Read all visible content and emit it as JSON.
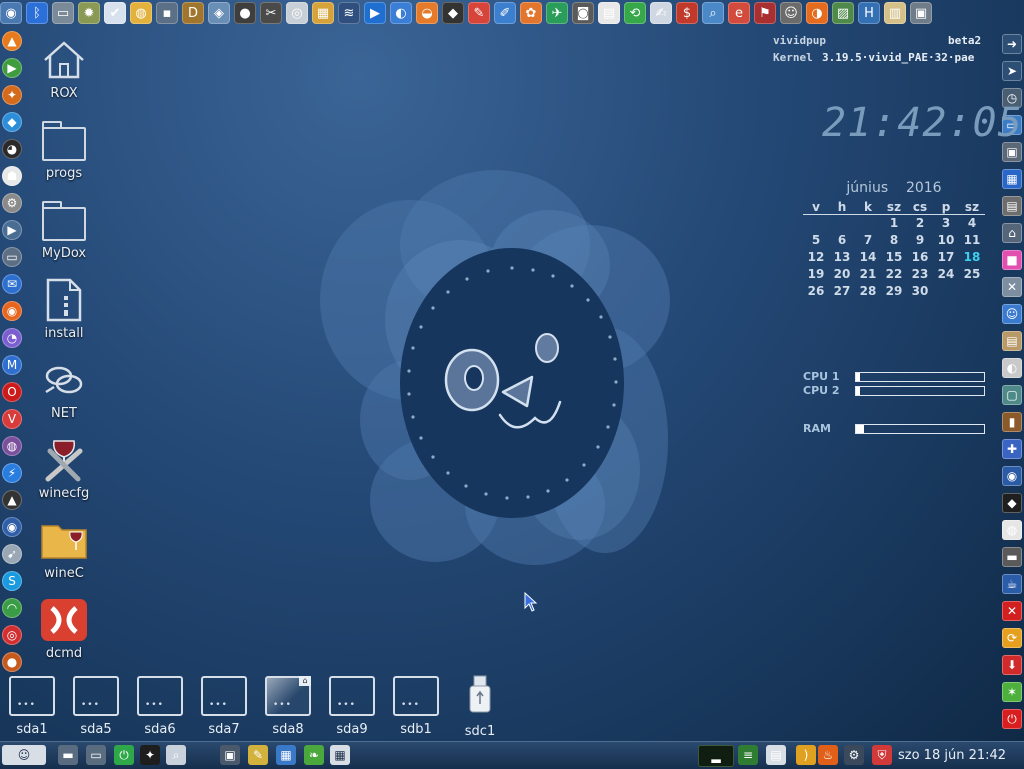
{
  "top_bar": {
    "icons": [
      {
        "name": "screenshot-icon",
        "glyph": "◉",
        "color": "#4a78b0"
      },
      {
        "name": "bluetooth-icon",
        "glyph": "ᛒ",
        "color": "#2b6fd8"
      },
      {
        "name": "drive-icon",
        "glyph": "▭",
        "color": "#7a8a99"
      },
      {
        "name": "sun-settings-icon",
        "glyph": "✹",
        "color": "#8a9a55"
      },
      {
        "name": "check-icon",
        "glyph": "✔",
        "color": "#d8e2ee"
      },
      {
        "name": "disc-icon",
        "glyph": "◍",
        "color": "#e3b23c"
      },
      {
        "name": "floppy-icon",
        "glyph": "▪",
        "color": "#5b6f86"
      },
      {
        "name": "dosbox-icon",
        "glyph": "D",
        "color": "#a0752d"
      },
      {
        "name": "cube-icon",
        "glyph": "◈",
        "color": "#6a8fb7"
      },
      {
        "name": "webcam-icon",
        "glyph": "●",
        "color": "#3e3e3e"
      },
      {
        "name": "tools-icon",
        "glyph": "✂",
        "color": "#4a4a4a"
      },
      {
        "name": "eye-icon",
        "glyph": "◎",
        "color": "#c8cfd6"
      },
      {
        "name": "film-icon",
        "glyph": "▦",
        "color": "#d6a33a"
      },
      {
        "name": "graph-icon",
        "glyph": "≋",
        "color": "#2f4f7f"
      },
      {
        "name": "media-player-icon",
        "glyph": "▶",
        "color": "#1f6fd0"
      },
      {
        "name": "network-icon",
        "glyph": "◐",
        "color": "#3a7ed6"
      },
      {
        "name": "blender-icon",
        "glyph": "◒",
        "color": "#e57b2a"
      },
      {
        "name": "inkscape-icon",
        "glyph": "◆",
        "color": "#333333"
      },
      {
        "name": "pencils-icon",
        "glyph": "✎",
        "color": "#d6443a"
      },
      {
        "name": "paint-icon",
        "glyph": "✐",
        "color": "#3c7fcf"
      },
      {
        "name": "xara-icon",
        "glyph": "✿",
        "color": "#e3762f"
      },
      {
        "name": "plane-icon",
        "glyph": "✈",
        "color": "#2a9d5a"
      },
      {
        "name": "camera-icon",
        "glyph": "◙",
        "color": "#5a5a5a"
      },
      {
        "name": "file-icon",
        "glyph": "▤",
        "color": "#e8e8e8"
      },
      {
        "name": "refresh-icon",
        "glyph": "⟲",
        "color": "#37a84a"
      },
      {
        "name": "notes-icon",
        "glyph": "✍",
        "color": "#cfd8e2"
      },
      {
        "name": "dollar-icon",
        "glyph": "$",
        "color": "#c0392b"
      },
      {
        "name": "magnifier-icon",
        "glyph": "⌕",
        "color": "#4b88c8"
      },
      {
        "name": "email-icon",
        "glyph": "e",
        "color": "#d24b3c"
      },
      {
        "name": "flag-icon",
        "glyph": "⚑",
        "color": "#a93030"
      },
      {
        "name": "pup-icon",
        "glyph": "☺",
        "color": "#6b6b6b"
      },
      {
        "name": "browser-icon",
        "glyph": "◑",
        "color": "#e56b1f"
      },
      {
        "name": "chart-icon",
        "glyph": "▨",
        "color": "#4f8a4a"
      },
      {
        "name": "h2-icon",
        "glyph": "H",
        "color": "#3470b4"
      },
      {
        "name": "book-icon",
        "glyph": "▥",
        "color": "#d4c088"
      },
      {
        "name": "chip-icon",
        "glyph": "▣",
        "color": "#6f7d8a"
      }
    ]
  },
  "left_dock": {
    "icons": [
      {
        "name": "vlc-icon",
        "glyph": "▲",
        "color": "#e67a1c"
      },
      {
        "name": "play-icon",
        "glyph": "▶",
        "color": "#3f9d3f"
      },
      {
        "name": "anchor-icon",
        "glyph": "✦",
        "color": "#d46a1c"
      },
      {
        "name": "kodi-icon",
        "glyph": "◆",
        "color": "#2c8dd8"
      },
      {
        "name": "penguin-icon",
        "glyph": "◕",
        "color": "#2a2a2a"
      },
      {
        "name": "ghost-icon",
        "glyph": "☗",
        "color": "#e8e8e8"
      },
      {
        "name": "tools-icon",
        "glyph": "⚙",
        "color": "#8a8a8a"
      },
      {
        "name": "media-icon",
        "glyph": "▶",
        "color": "#4a6d94"
      },
      {
        "name": "monitor-icon",
        "glyph": "▭",
        "color": "#5c6f84"
      },
      {
        "name": "thunderbird-icon",
        "glyph": "✉",
        "color": "#2c6fcf"
      },
      {
        "name": "firefox-icon",
        "glyph": "◉",
        "color": "#e8651e"
      },
      {
        "name": "pidgin-icon",
        "glyph": "◔",
        "color": "#7b5fd0"
      },
      {
        "name": "maxthon-icon",
        "glyph": "M",
        "color": "#2f6fd0"
      },
      {
        "name": "opera-icon",
        "glyph": "O",
        "color": "#cc1b1b"
      },
      {
        "name": "vivaldi-icon",
        "glyph": "V",
        "color": "#d93a3a"
      },
      {
        "name": "tor-icon",
        "glyph": "◍",
        "color": "#7a4f9c"
      },
      {
        "name": "messenger-icon",
        "glyph": "⚡",
        "color": "#2a7de0"
      },
      {
        "name": "triangle-icon",
        "glyph": "▲",
        "color": "#333333"
      },
      {
        "name": "earth-icon",
        "glyph": "◉",
        "color": "#2f5fa8"
      },
      {
        "name": "rocket-icon",
        "glyph": "➹",
        "color": "#9aa7b5"
      },
      {
        "name": "skype-icon",
        "glyph": "S",
        "color": "#1a9be0"
      },
      {
        "name": "rss-icon",
        "glyph": "◠",
        "color": "#3a9d45"
      },
      {
        "name": "lifebuoy-icon",
        "glyph": "◎",
        "color": "#d23030"
      },
      {
        "name": "orb-icon",
        "glyph": "●",
        "color": "#c65a1e"
      }
    ]
  },
  "right_dock": {
    "icons": [
      {
        "name": "logout-icon",
        "glyph": "➜",
        "color": "#2d4f75"
      },
      {
        "name": "cursor-icon",
        "glyph": "➤",
        "color": "#2d4f75"
      },
      {
        "name": "clock-icon",
        "glyph": "◷",
        "color": "#4a5e73"
      },
      {
        "name": "display-icon",
        "glyph": "▭",
        "color": "#3b7cc4"
      },
      {
        "name": "screen-icon",
        "glyph": "▣",
        "color": "#5a6878"
      },
      {
        "name": "driver-icon",
        "glyph": "▦",
        "color": "#2a66c8"
      },
      {
        "name": "printer-icon",
        "glyph": "▤",
        "color": "#6d6d6d"
      },
      {
        "name": "network-icon",
        "glyph": "⌂",
        "color": "#56667a"
      },
      {
        "name": "paint-icon",
        "glyph": "■",
        "color": "#e14fb0"
      },
      {
        "name": "wrench-icon",
        "glyph": "✕",
        "color": "#7d8ea0"
      },
      {
        "name": "face-icon",
        "glyph": "☺",
        "color": "#3a7bd0"
      },
      {
        "name": "doc-icon",
        "glyph": "▤",
        "color": "#b79a67"
      },
      {
        "name": "disc-icon",
        "glyph": "◐",
        "color": "#c9c9c9"
      },
      {
        "name": "monitor-icon",
        "glyph": "▢",
        "color": "#4f8a88"
      },
      {
        "name": "bottle-icon",
        "glyph": "▮",
        "color": "#8a5a2b"
      },
      {
        "name": "puzzle-icon",
        "glyph": "✚",
        "color": "#3a64c2"
      },
      {
        "name": "globe-icon",
        "glyph": "◉",
        "color": "#2c5ba6"
      },
      {
        "name": "diamond-icon",
        "glyph": "◆",
        "color": "#1f1f1f"
      },
      {
        "name": "snes-icon",
        "glyph": "◍",
        "color": "#e6e6e6"
      },
      {
        "name": "drive-icon",
        "glyph": "▬",
        "color": "#5a5a5a"
      },
      {
        "name": "java-icon",
        "glyph": "☕",
        "color": "#2a5ca8"
      },
      {
        "name": "close-icon",
        "glyph": "✕",
        "color": "#d22020"
      },
      {
        "name": "reboot-icon",
        "glyph": "⟳",
        "color": "#e6a020"
      },
      {
        "name": "download-icon",
        "glyph": "⬇",
        "color": "#d02a2a"
      },
      {
        "name": "sparkle-icon",
        "glyph": "✶",
        "color": "#4db03c"
      },
      {
        "name": "power-icon",
        "glyph": "⏻",
        "color": "#d81e1e"
      }
    ]
  },
  "desktop_icons": [
    {
      "label": "ROX",
      "type": "home"
    },
    {
      "label": "progs",
      "type": "folder"
    },
    {
      "label": "MyDox",
      "type": "folder"
    },
    {
      "label": "install",
      "type": "install"
    },
    {
      "label": "NET",
      "type": "net"
    },
    {
      "label": "winecfg",
      "type": "winecfg"
    },
    {
      "label": "wineC",
      "type": "winefolder"
    },
    {
      "label": "dcmd",
      "type": "dcmd"
    }
  ],
  "drives": [
    {
      "label": "sda1",
      "type": "disk"
    },
    {
      "label": "sda5",
      "type": "disk"
    },
    {
      "label": "sda6",
      "type": "disk"
    },
    {
      "label": "sda7",
      "type": "disk"
    },
    {
      "label": "sda8",
      "type": "disk-mounted"
    },
    {
      "label": "sda9",
      "type": "disk"
    },
    {
      "label": "sdb1",
      "type": "disk"
    },
    {
      "label": "sdc1",
      "type": "usb"
    }
  ],
  "sysinfo": {
    "distro": "vividpup",
    "release": "beta2",
    "kernel_label": "Kernel",
    "kernel_version": "3.19.5·vivid_PAE·32·pae",
    "time": "21:42:05"
  },
  "calendar": {
    "month": "június",
    "year": "2016",
    "weekdays": [
      "v",
      "h",
      "k",
      "sz",
      "cs",
      "p",
      "sz"
    ],
    "weeks": [
      [
        "",
        "",
        "",
        "1",
        "2",
        "3",
        "4"
      ],
      [
        "5",
        "6",
        "7",
        "8",
        "9",
        "10",
        "11"
      ],
      [
        "12",
        "13",
        "14",
        "15",
        "16",
        "17",
        "18"
      ],
      [
        "19",
        "20",
        "21",
        "22",
        "23",
        "24",
        "25"
      ],
      [
        "26",
        "27",
        "28",
        "29",
        "30",
        "",
        ""
      ]
    ],
    "today": "18"
  },
  "meters": [
    {
      "label": "CPU 1",
      "fraction": 0.02
    },
    {
      "label": "CPU 2",
      "fraction": 0.02
    },
    {
      "label": "RAM",
      "fraction": 0.06
    }
  ],
  "taskbar": {
    "datetime": "szo 18 jún 21:42",
    "left_icons": [
      {
        "name": "menu-button-icon",
        "glyph": "☺",
        "color": "#d8dee6"
      },
      {
        "name": "terminal-icon",
        "glyph": "▬",
        "color": "#5a6c80"
      },
      {
        "name": "drive-icon",
        "glyph": "▭",
        "color": "#5a6c80"
      },
      {
        "name": "power-icon",
        "glyph": "⏻",
        "color": "#2fa84a"
      },
      {
        "name": "runner-icon",
        "glyph": "✦",
        "color": "#1e1e1e"
      },
      {
        "name": "search-icon",
        "glyph": "⌕",
        "color": "#c9d2dc"
      },
      {
        "name": "monitor-icon",
        "glyph": "▣",
        "color": "#4a5a6c"
      },
      {
        "name": "broom-icon",
        "glyph": "✎",
        "color": "#d2b23c"
      },
      {
        "name": "calculator-icon",
        "glyph": "▦",
        "color": "#3a78c8"
      },
      {
        "name": "leaf-icon",
        "glyph": "❧",
        "color": "#4ba83c"
      },
      {
        "name": "grid-icon",
        "glyph": "▦",
        "color": "#d8dee6"
      }
    ],
    "tray_icons": [
      {
        "name": "cpu-graph-icon",
        "glyph": "▂",
        "color": "#0f1e10"
      },
      {
        "name": "network-status-icon",
        "glyph": "≡",
        "color": "#2e7d32"
      },
      {
        "name": "clipboard-icon",
        "glyph": "▤",
        "color": "#d8dee6"
      },
      {
        "name": "wifi-icon",
        "glyph": ")",
        "color": "#e0a020"
      },
      {
        "name": "firewall-icon",
        "glyph": "♨",
        "color": "#e0601a"
      },
      {
        "name": "update-icon",
        "glyph": "⚙",
        "color": "#3a4a5c"
      },
      {
        "name": "shield-icon",
        "glyph": "⛨",
        "color": "#d23a3a"
      }
    ]
  }
}
